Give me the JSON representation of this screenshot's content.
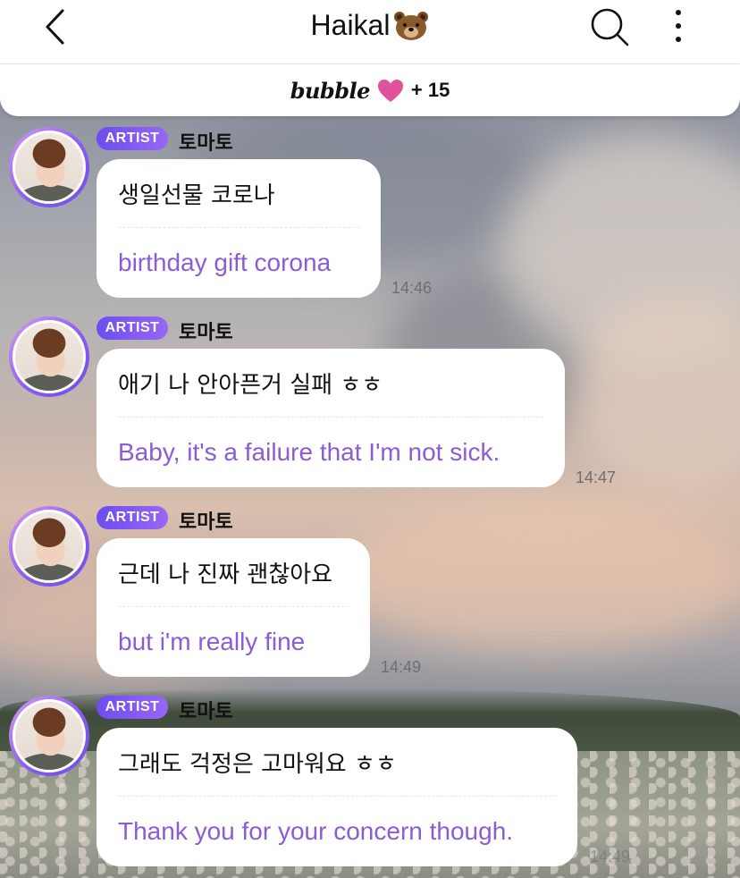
{
  "header": {
    "title": "Haikal",
    "title_emoji": "bear-face-icon",
    "back_icon": "chevron-left-icon",
    "search_icon": "search-icon",
    "more_icon": "more-vertical-icon"
  },
  "banner": {
    "logo": "bubble",
    "heart_icon": "heart-icon",
    "count": "+ 15"
  },
  "colors": {
    "translation_text": "#8a5cd6",
    "artist_badge": "#7a55f2",
    "header_bg": "#ffffff"
  },
  "messages": [
    {
      "badge": "ARTIST",
      "sender": "토마토",
      "original": "생일선물 코로나",
      "translation": "birthday gift corona",
      "time": "14:46"
    },
    {
      "badge": "ARTIST",
      "sender": "토마토",
      "original": "애기 나 안아픈거 실패 ㅎㅎ",
      "translation": "Baby, it's a failure that I'm not sick.",
      "time": "14:47"
    },
    {
      "badge": "ARTIST",
      "sender": "토마토",
      "original": "근데 나 진짜 괜찮아요",
      "translation": "but i'm really fine",
      "time": "14:49"
    },
    {
      "badge": "ARTIST",
      "sender": "토마토",
      "original": "그래도 걱정은 고마워요 ㅎㅎ",
      "translation": "Thank you for your concern though.",
      "time": "14:49"
    }
  ]
}
